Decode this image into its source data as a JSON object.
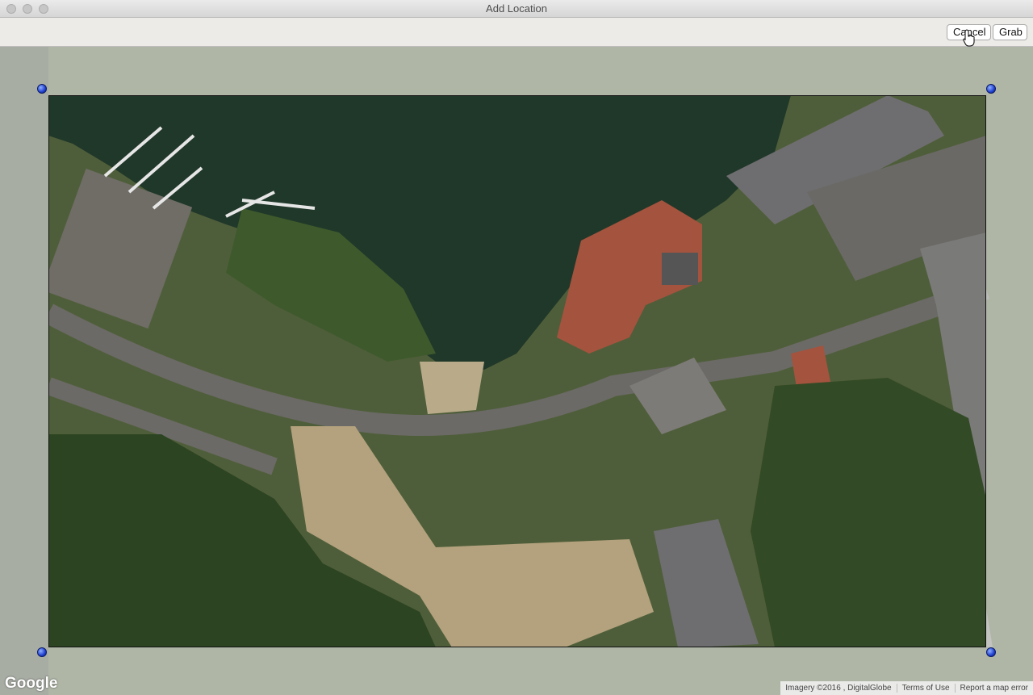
{
  "window": {
    "title": "Add Location"
  },
  "toolbar": {
    "cancel_label": "Cancel",
    "grab_label": "Grab"
  },
  "map": {
    "logo": "Google",
    "attribution": "Imagery ©2016 , DigitalGlobe",
    "terms_link": "Terms of Use",
    "report_link": "Report a map error",
    "view": "satellite"
  },
  "icons": {
    "traffic_lights": [
      "close-icon",
      "minimize-icon",
      "zoom-icon"
    ],
    "pointer": "hand-pointer-icon",
    "corner_handles": "pin-handle-icon"
  },
  "colors": {
    "handle": "#1f3fcf",
    "selection_border": "#111111",
    "water": "#1f3a2a"
  }
}
